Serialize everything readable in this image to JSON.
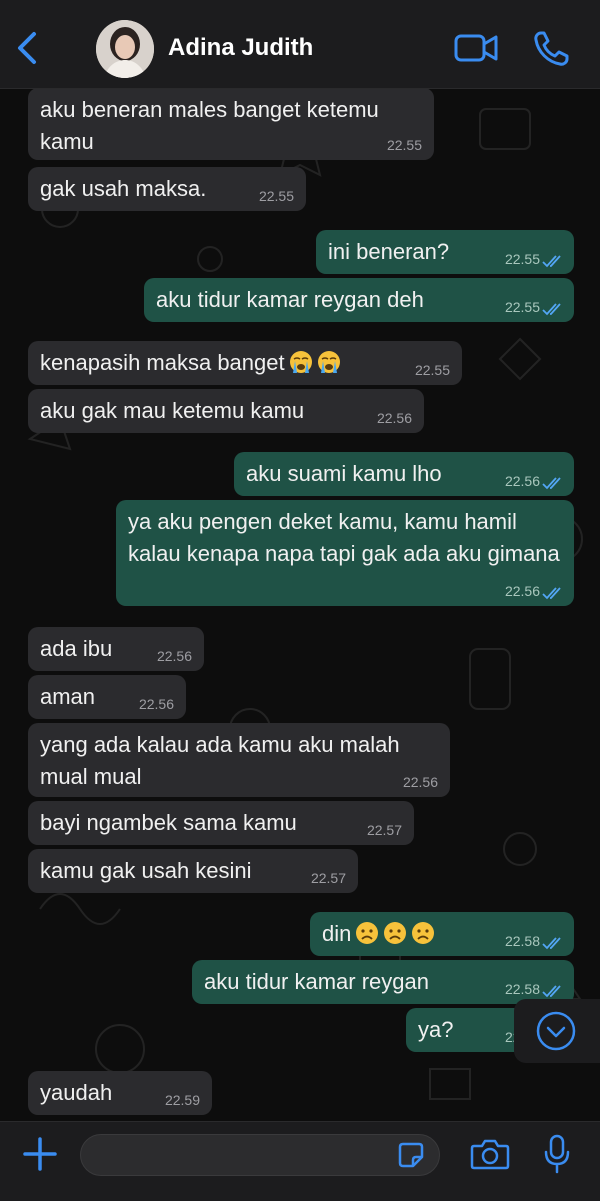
{
  "header": {
    "contact_name": "Adina Judith"
  },
  "composer": {
    "placeholder": ""
  },
  "messages": [
    {
      "dir": "in",
      "text": "aku beneran males banget ketemu kamu",
      "time": "22.55"
    },
    {
      "dir": "in",
      "text": "gak usah maksa.",
      "time": "22.55"
    },
    {
      "dir": "out",
      "text": "ini beneran?",
      "time": "22.55"
    },
    {
      "dir": "out",
      "text": "aku tidur kamar reygan deh",
      "time": "22.55"
    },
    {
      "dir": "in",
      "text": "kenapasih maksa banget",
      "emoji": [
        "crying-face",
        "crying-face"
      ],
      "time": "22.55"
    },
    {
      "dir": "in",
      "text": "aku gak mau ketemu kamu",
      "time": "22.56"
    },
    {
      "dir": "out",
      "text": "aku suami kamu lho",
      "time": "22.56"
    },
    {
      "dir": "out",
      "text": "ya aku pengen deket kamu, kamu hamil kalau kenapa napa tapi gak ada aku gimana",
      "time": "22.56"
    },
    {
      "dir": "in",
      "text": "ada ibu",
      "time": "22.56"
    },
    {
      "dir": "in",
      "text": "aman",
      "time": "22.56"
    },
    {
      "dir": "in",
      "text": "yang ada kalau ada kamu aku malah mual mual",
      "time": "22.56"
    },
    {
      "dir": "in",
      "text": "bayi ngambek sama kamu",
      "time": "22.57"
    },
    {
      "dir": "in",
      "text": "kamu gak usah kesini",
      "time": "22.57"
    },
    {
      "dir": "out",
      "text": "din",
      "emoji": [
        "frowning-face",
        "frowning-face",
        "frowning-face"
      ],
      "time": "22.58"
    },
    {
      "dir": "out",
      "text": "aku tidur kamar reygan",
      "time": "22.58"
    },
    {
      "dir": "out",
      "text": "ya?",
      "time": "22.58"
    },
    {
      "dir": "in",
      "text": "yaudah",
      "time": "22.59"
    }
  ],
  "colors": {
    "accent": "#3a8cf0",
    "incoming": "#2b2b2e",
    "outgoing": "#1f5246"
  },
  "icons": [
    "back-chevron-icon",
    "video-call-icon",
    "phone-call-icon",
    "plus-icon",
    "sticker-icon",
    "camera-icon",
    "microphone-icon",
    "scroll-down-icon",
    "double-check-icon"
  ]
}
